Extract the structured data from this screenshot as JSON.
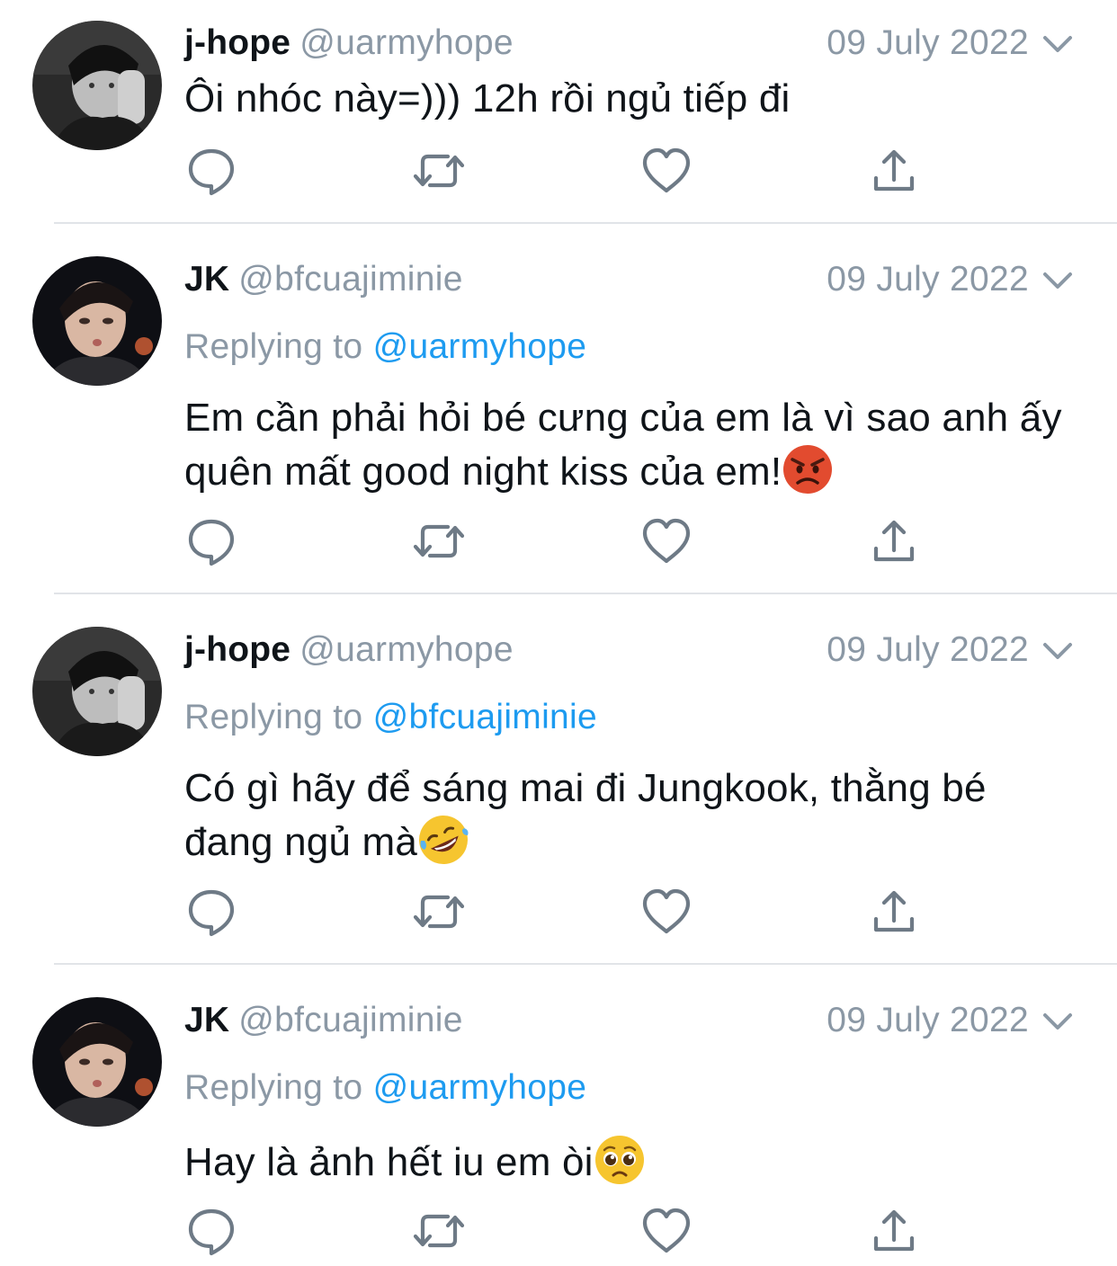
{
  "tweets": [
    {
      "name": "j-hope",
      "handle": "@uarmyhope",
      "date": "09 July 2022",
      "replying_prefix": "",
      "replying_to": "",
      "text": "Ôi nhóc này=))) 12h rồi ngủ tiếp đi",
      "emoji": "",
      "avatar": "grayscale-portrait"
    },
    {
      "name": "JK",
      "handle": "@bfcuajiminie",
      "date": "09 July 2022",
      "replying_prefix": "Replying to",
      "replying_to": "@uarmyhope",
      "text": "Em cần phải hỏi bé cưng của em là vì sao anh ấy quên mất good night kiss của em!",
      "emoji": "angry-face",
      "avatar": "night-portrait"
    },
    {
      "name": "j-hope",
      "handle": "@uarmyhope",
      "date": "09 July 2022",
      "replying_prefix": "Replying to",
      "replying_to": "@bfcuajiminie",
      "text": "Có gì hãy để sáng mai đi Jungkook, thằng bé đang ngủ mà",
      "emoji": "rolling-laughing-face",
      "avatar": "grayscale-portrait"
    },
    {
      "name": "JK",
      "handle": "@bfcuajiminie",
      "date": "09 July 2022",
      "replying_prefix": "Replying to",
      "replying_to": "@uarmyhope",
      "text": "Hay là ảnh hết iu em òi",
      "emoji": "pleading-face",
      "avatar": "night-portrait"
    }
  ],
  "actions": [
    "reply-icon",
    "retweet-icon",
    "like-icon",
    "share-icon"
  ],
  "colors": {
    "name": "#0f1419",
    "meta": "#8b98a5",
    "link": "#1d9bf0",
    "icon": "#6e7a86",
    "divider": "#e1e4e8"
  }
}
